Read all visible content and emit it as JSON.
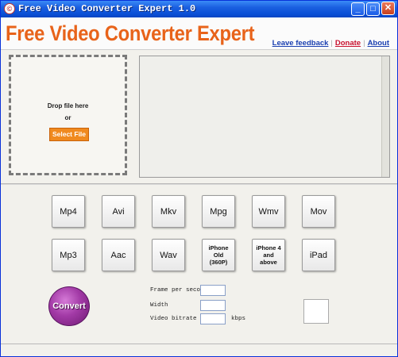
{
  "window": {
    "title": "Free Video Converter Expert 1.0",
    "controls": {
      "minimize": "_",
      "maximize": "□",
      "close": "✕"
    }
  },
  "header": {
    "brand": "Free Video Converter Expert",
    "links": {
      "feedback": "Leave feedback",
      "donate": "Donate",
      "about": "About"
    }
  },
  "dropzone": {
    "line1": "Drop file here",
    "line2": "or",
    "button": "Select File"
  },
  "formats": {
    "mp4": "Mp4",
    "avi": "Avi",
    "mkv": "Mkv",
    "mpg": "Mpg",
    "wmv": "Wmv",
    "mov": "Mov",
    "mp3": "Mp3",
    "aac": "Aac",
    "wav": "Wav",
    "iphone_old": "iPhone Old (360P)",
    "iphone_new": "iPhone 4 and above",
    "ipad": "iPad"
  },
  "convert": {
    "label": "Convert"
  },
  "params": {
    "fps_label": "Frame per second",
    "fps_value": "",
    "width_label": "Width",
    "width_value": "",
    "bitrate_label": "Video bitrate",
    "bitrate_value": "",
    "bitrate_unit": "kbps"
  },
  "colors": {
    "accent": "#e8631a",
    "titlebar": "#0a4fd6",
    "convert": "#a23aa6",
    "select_button": "#f08a1f"
  },
  "icons": {
    "app": "app-logo-icon"
  }
}
